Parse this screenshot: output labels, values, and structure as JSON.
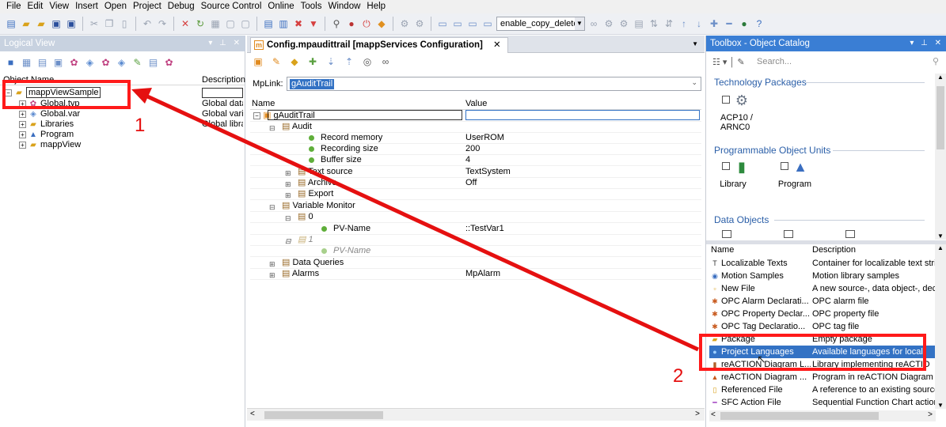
{
  "menu": [
    "File",
    "Edit",
    "View",
    "Insert",
    "Open",
    "Project",
    "Debug",
    "Source Control",
    "Online",
    "Tools",
    "Window",
    "Help"
  ],
  "toolbar": {
    "config_combo": "enable_copy_delete"
  },
  "logical_view": {
    "title": "Logical View",
    "columns": {
      "name": "Object Name",
      "description": "Description"
    },
    "tree": [
      {
        "name": "mappViewSample",
        "description": ""
      },
      {
        "name": "Global.typ",
        "description": "Global data"
      },
      {
        "name": "Global.var",
        "description": "Global vari"
      },
      {
        "name": "Libraries",
        "description": "Global libra"
      },
      {
        "name": "Program",
        "description": ""
      },
      {
        "name": "mappView",
        "description": ""
      }
    ]
  },
  "editor": {
    "tab_title": "Config.mpaudittrail [mappServices Configuration]",
    "tab_close": "✕",
    "mplink_label": "MpLink:",
    "mplink_value": "gAuditTrail",
    "columns": {
      "name": "Name",
      "value": "Value"
    },
    "rows": [
      {
        "name": "gAuditTrail",
        "value": ""
      },
      {
        "name": "Audit",
        "value": ""
      },
      {
        "name": "Record memory",
        "value": "UserROM"
      },
      {
        "name": "Recording size",
        "value": "200"
      },
      {
        "name": "Buffer size",
        "value": "4"
      },
      {
        "name": "Text source",
        "value": "TextSystem"
      },
      {
        "name": "Archive",
        "value": "Off"
      },
      {
        "name": "Export",
        "value": ""
      },
      {
        "name": "Variable Monitor",
        "value": ""
      },
      {
        "name": "0",
        "value": ""
      },
      {
        "name": "PV-Name",
        "value": "::TestVar1"
      },
      {
        "name": "1",
        "value": ""
      },
      {
        "name": "PV-Name",
        "value": ""
      },
      {
        "name": "Data Queries",
        "value": ""
      },
      {
        "name": "Alarms",
        "value": "MpAlarm"
      }
    ]
  },
  "toolbox": {
    "title": "Toolbox - Object Catalog",
    "search_placeholder": "Search...",
    "categories": [
      {
        "title": "Technology Packages",
        "items": [
          "ACP10 / ARNC0"
        ]
      },
      {
        "title": "Programmable Object Units",
        "items": [
          "Library",
          "Program"
        ]
      },
      {
        "title": "Data Objects",
        "items": []
      }
    ],
    "list_columns": {
      "name": "Name",
      "description": "Description"
    },
    "list": [
      {
        "name": "Localizable Texts",
        "description": "Container for localizable text strin"
      },
      {
        "name": "Motion Samples",
        "description": "Motion library samples"
      },
      {
        "name": "New File",
        "description": "A new source-, data object-, dec"
      },
      {
        "name": "OPC Alarm Declarati...",
        "description": "OPC alarm file"
      },
      {
        "name": "OPC Property Declar...",
        "description": "OPC property file"
      },
      {
        "name": "OPC Tag Declaratio...",
        "description": "OPC tag file"
      },
      {
        "name": "Package",
        "description": "Empty package"
      },
      {
        "name": "Project Languages",
        "description": "Available languages for locali"
      },
      {
        "name": "reACTION Diagram L...",
        "description": "Library implementing reACTIO"
      },
      {
        "name": "reACTION Diagram ...",
        "description": "Program in reACTION Diagram"
      },
      {
        "name": "Referenced File",
        "description": "A reference to an existing source"
      },
      {
        "name": "SFC Action File",
        "description": "Sequential Function Chart action"
      }
    ]
  },
  "annotations": {
    "label_1": "1",
    "label_2": "2",
    "color": "#e51010"
  }
}
